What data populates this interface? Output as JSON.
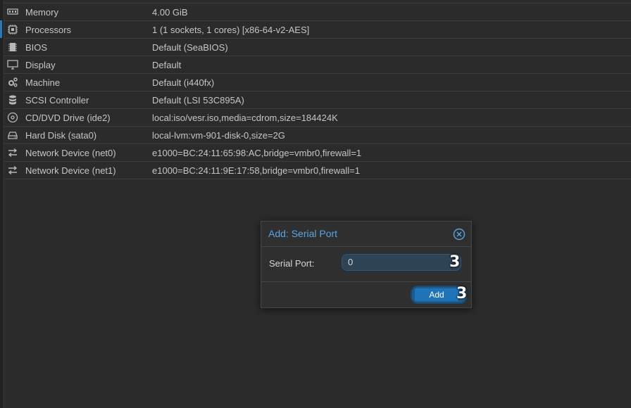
{
  "hardware": {
    "rows": [
      {
        "icon": "memory-icon",
        "key": "Memory",
        "value": "4.00 GiB"
      },
      {
        "icon": "cpu-icon",
        "key": "Processors",
        "value": "1 (1 sockets, 1 cores) [x86-64-v2-AES]"
      },
      {
        "icon": "bios-chip-icon",
        "key": "BIOS",
        "value": "Default (SeaBIOS)"
      },
      {
        "icon": "monitor-icon",
        "key": "Display",
        "value": "Default"
      },
      {
        "icon": "cogs-icon",
        "key": "Machine",
        "value": "Default (i440fx)"
      },
      {
        "icon": "database-icon",
        "key": "SCSI Controller",
        "value": "Default (LSI 53C895A)"
      },
      {
        "icon": "cdrom-icon",
        "key": "CD/DVD Drive (ide2)",
        "value": "local:iso/vesr.iso,media=cdrom,size=184424K"
      },
      {
        "icon": "hard-disk-icon",
        "key": "Hard Disk (sata0)",
        "value": "local-lvm:vm-901-disk-0,size=2G"
      },
      {
        "icon": "network-icon",
        "key": "Network Device (net0)",
        "value": "e1000=BC:24:11:65:98:AC,bridge=vmbr0,firewall=1"
      },
      {
        "icon": "network-icon",
        "key": "Network Device (net1)",
        "value": "e1000=BC:24:11:9E:17:58,bridge=vmbr0,firewall=1"
      }
    ]
  },
  "dialog": {
    "title": "Add: Serial Port",
    "field_label": "Serial Port:",
    "field_value": "0",
    "field_badge": "3",
    "add_label": "Add",
    "add_badge": "3"
  },
  "colors": {
    "accent": "#58a6e6",
    "button": "#1f74b8",
    "background": "#2b2b2b"
  }
}
